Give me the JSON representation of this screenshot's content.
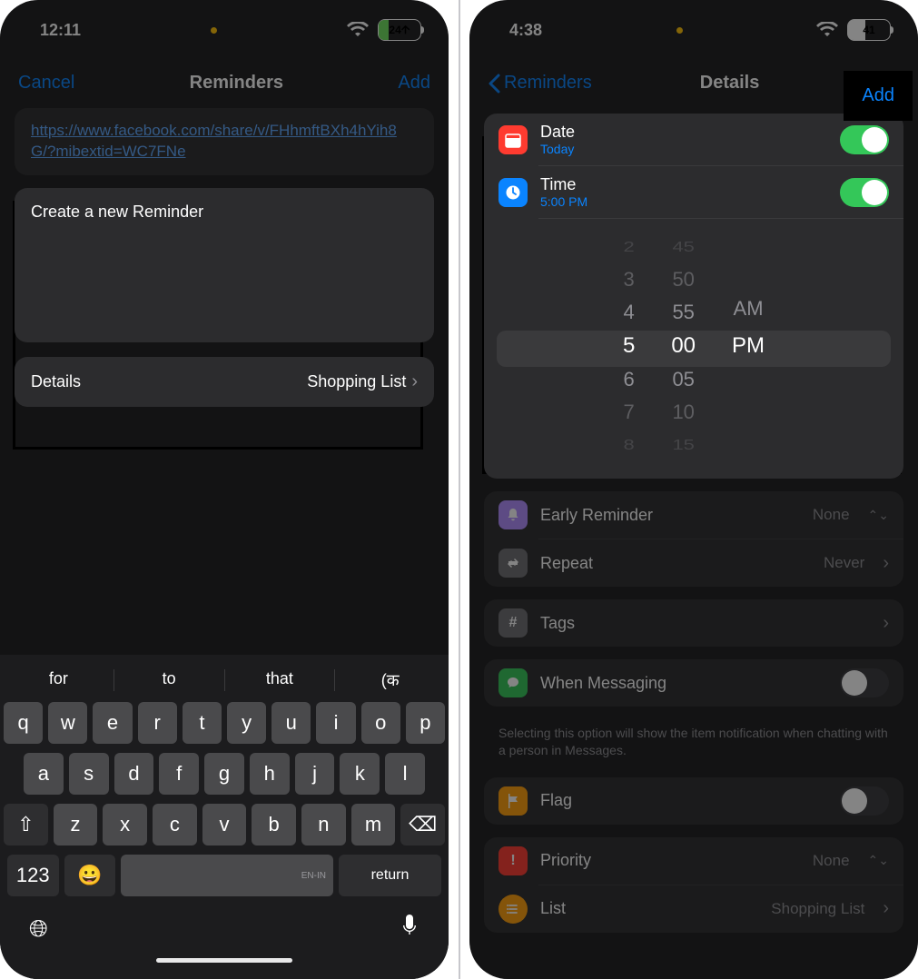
{
  "left": {
    "status": {
      "time": "12:11",
      "battery": "24"
    },
    "nav": {
      "cancel": "Cancel",
      "title": "Reminders",
      "add": "Add"
    },
    "link": "https://www.facebook.com/share/v/FHhmftBXh4hYih8G/?mibextid=WC7FNe",
    "textarea": "Create a new Reminder",
    "details": {
      "label": "Details",
      "value": "Shopping List"
    },
    "keyboard": {
      "sugg": [
        "for",
        "to",
        "that",
        "(क"
      ],
      "row1": [
        "q",
        "w",
        "e",
        "r",
        "t",
        "y",
        "u",
        "i",
        "o",
        "p"
      ],
      "row2": [
        "a",
        "s",
        "d",
        "f",
        "g",
        "h",
        "j",
        "k",
        "l"
      ],
      "row3": [
        "z",
        "x",
        "c",
        "v",
        "b",
        "n",
        "m"
      ],
      "numKey": "123",
      "returnKey": "return",
      "lang": "EN-IN"
    }
  },
  "right": {
    "status": {
      "time": "4:38",
      "battery": "41"
    },
    "nav": {
      "back": "Reminders",
      "title": "Details",
      "add": "Add"
    },
    "date": {
      "label": "Date",
      "value": "Today"
    },
    "time": {
      "label": "Time",
      "value": "5:00 PM"
    },
    "picker": {
      "hours": [
        "2",
        "3",
        "4",
        "5",
        "6",
        "7",
        "8"
      ],
      "mins": [
        "45",
        "50",
        "55",
        "00",
        "05",
        "10",
        "15"
      ],
      "ampm": [
        "AM",
        "PM"
      ]
    },
    "early": {
      "label": "Early Reminder",
      "value": "None"
    },
    "repeat": {
      "label": "Repeat",
      "value": "Never"
    },
    "tags": {
      "label": "Tags"
    },
    "messaging": {
      "label": "When Messaging",
      "help": "Selecting this option will show the item notification when chatting with a person in Messages."
    },
    "flag": {
      "label": "Flag"
    },
    "priority": {
      "label": "Priority",
      "value": "None"
    },
    "list": {
      "label": "List",
      "value": "Shopping List"
    }
  }
}
